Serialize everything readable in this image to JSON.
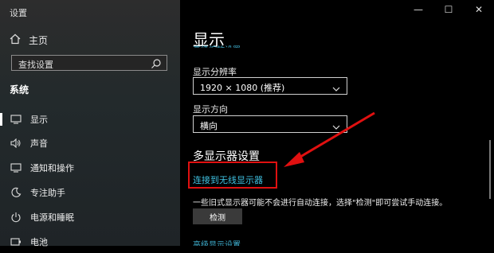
{
  "window": {
    "title": "设置",
    "controls": [
      "—",
      "☐",
      "✕"
    ]
  },
  "sidebar": {
    "home_label": "主页",
    "search_placeholder": "查找设置",
    "section_title": "系统",
    "items": [
      {
        "label": "显示",
        "icon": "monitor-icon",
        "active": true
      },
      {
        "label": "声音",
        "icon": "speaker-icon"
      },
      {
        "label": "通知和操作",
        "icon": "notification-icon"
      },
      {
        "label": "专注助手",
        "icon": "moon-icon"
      },
      {
        "label": "电源和睡眠",
        "icon": "power-icon"
      },
      {
        "label": "电池",
        "icon": "battery-icon"
      }
    ]
  },
  "main": {
    "title": "显示",
    "cutoff_link": "高级缩放设置",
    "resolution_label": "显示分辨率",
    "resolution_value": "1920 × 1080 (推荐)",
    "orientation_label": "显示方向",
    "orientation_value": "横向",
    "multi_display_title": "多显示器设置",
    "wireless_link": "连接到无线显示器",
    "description": "一些旧式显示器可能不会进行自动连接，选择\"检测\"即可尝试手动连接。",
    "detect_button": "检测",
    "advanced_link": "高级显示设置"
  },
  "colors": {
    "accent": "#3fc0e0",
    "highlight": "#e01010"
  }
}
